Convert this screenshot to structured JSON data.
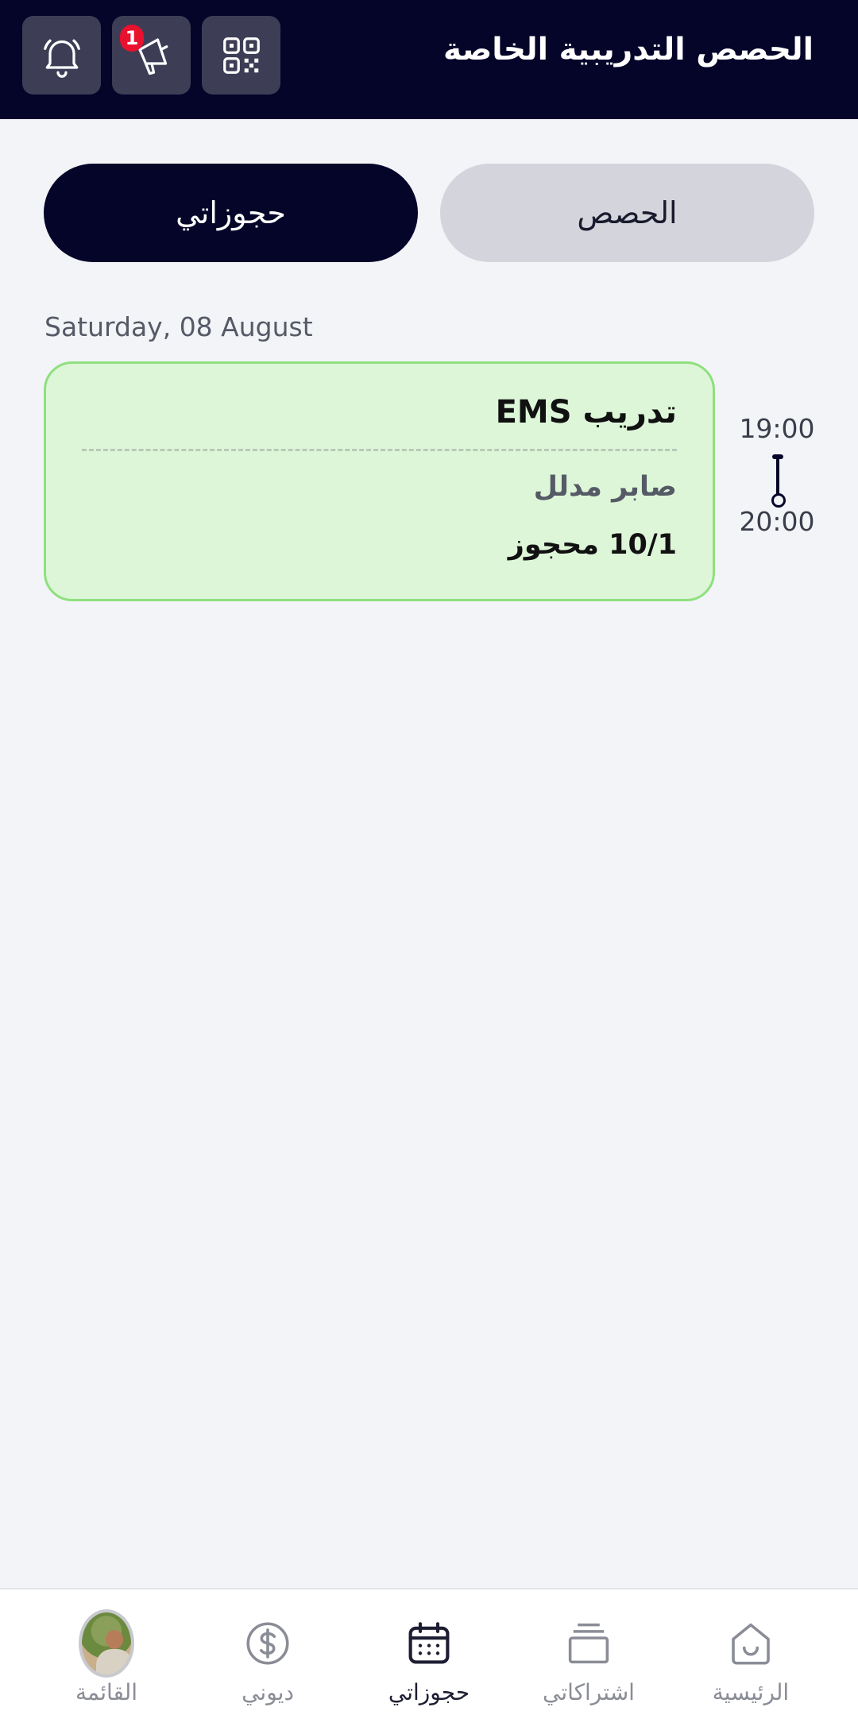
{
  "header": {
    "title": "الحصص التدريبية الخاصة",
    "notifications_icon": "bell-icon",
    "announcements_icon": "megaphone-icon",
    "announcements_badge": "1",
    "qr_icon": "qr-code-icon"
  },
  "segments": {
    "classes_label": "الحصص",
    "my_bookings_label": "حجوزاتي",
    "active": "my_bookings"
  },
  "bookings": {
    "date": "Saturday, 08 August",
    "items": [
      {
        "start_time": "19:00",
        "end_time": "20:00",
        "title": "تدريب  EMS",
        "trainer": "صابر مدلل",
        "booked": "10/1 محجوز"
      }
    ]
  },
  "nav": {
    "items": [
      {
        "label": "الرئيسية",
        "icon": "home-icon"
      },
      {
        "label": "اشتراكاتي",
        "icon": "subscriptions-icon"
      },
      {
        "label": "حجوزاتي",
        "icon": "calendar-icon",
        "active": true
      },
      {
        "label": "ديوني",
        "icon": "dollar-icon"
      },
      {
        "label": "القائمة",
        "icon": "avatar"
      }
    ]
  },
  "colors": {
    "header_bg": "#05052a",
    "card_bg": "#ddf6d8",
    "card_border": "#8fe07e",
    "badge": "#e8112e"
  }
}
